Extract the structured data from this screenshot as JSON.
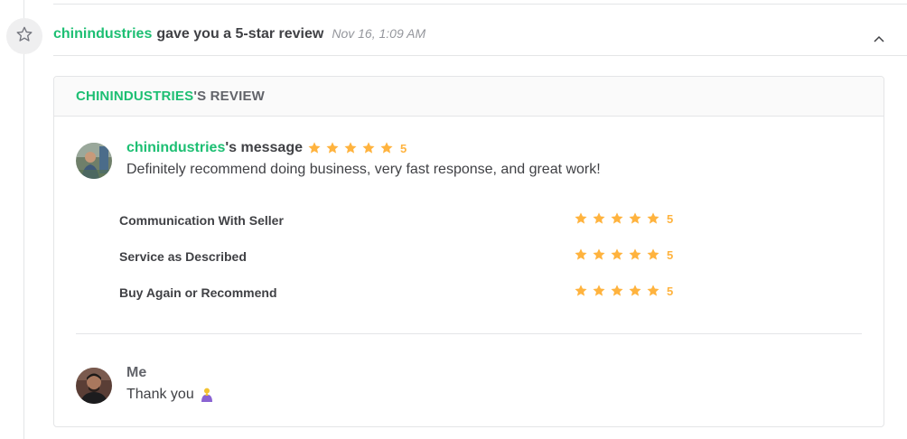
{
  "event": {
    "username": "chinindustries",
    "action_text": "gave you a 5-star review",
    "timestamp": "Nov 16, 1:09 AM",
    "icon": "star-outline-icon",
    "collapse_icon": "chevron-up-icon"
  },
  "review_card": {
    "title_user": "CHININDUSTRIES",
    "title_suffix": "'S REVIEW",
    "message": {
      "username": "chinindustries",
      "label_suffix": "'s message",
      "rating": "5",
      "stars": 5,
      "text": "Definitely recommend doing business, very fast response, and great work!"
    },
    "criteria": [
      {
        "label": "Communication With Seller",
        "rating": "5",
        "stars": 5
      },
      {
        "label": "Service as Described",
        "rating": "5",
        "stars": 5
      },
      {
        "label": "Buy Again or Recommend",
        "rating": "5",
        "stars": 5
      }
    ],
    "reply": {
      "name": "Me",
      "text": "Thank you",
      "emoji": "person-bowing-emoji"
    }
  },
  "colors": {
    "accent_green": "#1dbf73",
    "star_orange": "#ffb33e",
    "text_dark": "#404145",
    "text_muted": "#62646a"
  }
}
